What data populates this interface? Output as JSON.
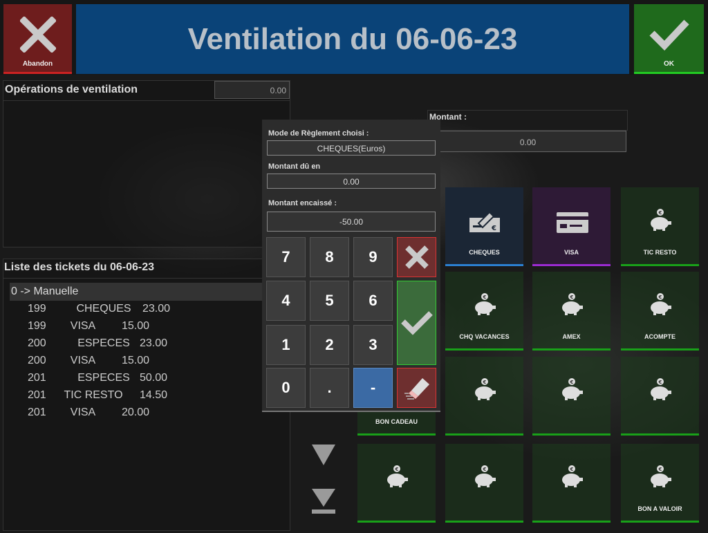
{
  "header": {
    "cancel_label": "Abandon",
    "title": "Ventilation du 06-06-23",
    "ok_label": "OK"
  },
  "operations": {
    "title": "Opérations de ventilation",
    "total": "0.00"
  },
  "tickets": {
    "title": "Liste des tickets du 06-06-23",
    "group": "0 -> Manuelle",
    "rows": [
      {
        "num": "199",
        "mode": "CHEQUES",
        "amount": "23.00"
      },
      {
        "num": "199",
        "mode": "VISA",
        "amount": "15.00"
      },
      {
        "num": "200",
        "mode": "ESPECES",
        "amount": "23.00"
      },
      {
        "num": "200",
        "mode": "VISA",
        "amount": "15.00"
      },
      {
        "num": "201",
        "mode": "ESPECES",
        "amount": "50.00"
      },
      {
        "num": "201",
        "mode": "TIC RESTO",
        "amount": "14.50"
      },
      {
        "num": "201",
        "mode": "VISA",
        "amount": "20.00"
      }
    ]
  },
  "montant": {
    "label": "Montant :",
    "value": "0.00"
  },
  "popup": {
    "mode_label": "Mode de Règlement choisi :",
    "mode_value": "CHEQUES(Euros)",
    "due_label": "Montant dû en",
    "due_value": "0.00",
    "paid_label": "Montant encaissé :",
    "paid_value": "-50.00",
    "keys": [
      "7",
      "8",
      "9",
      "4",
      "5",
      "6",
      "1",
      "2",
      "3",
      "0",
      ".",
      "-"
    ]
  },
  "tiles": [
    {
      "label": "CHEQUES",
      "icon": "cheque-icon"
    },
    {
      "label": "VISA",
      "icon": "credit-card-icon"
    },
    {
      "label": "TIC RESTO",
      "icon": "piggy-bank-icon"
    },
    {
      "label": "CHQ VACANCES",
      "icon": "piggy-bank-icon"
    },
    {
      "label": "AMEX",
      "icon": "piggy-bank-icon"
    },
    {
      "label": "ACOMPTE",
      "icon": "piggy-bank-icon"
    },
    {
      "label": "BON CADEAU",
      "icon": "piggy-bank-icon"
    },
    {
      "label": "",
      "icon": "piggy-bank-icon"
    },
    {
      "label": "",
      "icon": "piggy-bank-icon"
    },
    {
      "label": "",
      "icon": "piggy-bank-icon"
    },
    {
      "label": "",
      "icon": "piggy-bank-icon"
    },
    {
      "label": "",
      "icon": "piggy-bank-icon"
    },
    {
      "label": "",
      "icon": "piggy-bank-icon"
    },
    {
      "label": "BON A VALOIR",
      "icon": "piggy-bank-icon"
    }
  ],
  "colors": {
    "cancel": "#6e1d1d",
    "title_bar": "#0a4378",
    "ok": "#1f6a1c",
    "tile_green_border": "#19a019",
    "cheques_border": "#2b7fd0",
    "visa_border": "#9a2bd0",
    "minus_key": "#3b6aa4"
  }
}
